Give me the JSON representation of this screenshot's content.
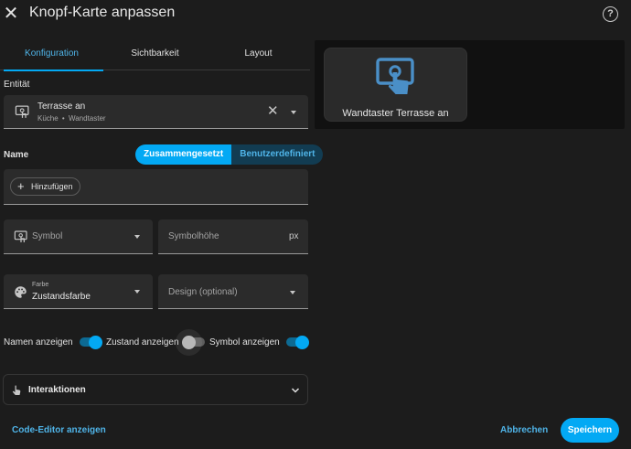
{
  "header": {
    "title": "Knopf-Karte anpassen",
    "close_icon": "close-icon",
    "help_icon": "help-circle-icon"
  },
  "tabs": [
    {
      "label": "Konfiguration",
      "active": true
    },
    {
      "label": "Sichtbarkeit",
      "active": false
    },
    {
      "label": "Layout",
      "active": false
    }
  ],
  "entity": {
    "section_label": "Entität",
    "name": "Terrasse an",
    "area": "Küche",
    "device": "Wandtaster",
    "separator": "•"
  },
  "name_section": {
    "label": "Name",
    "mode_options": [
      "Zusammengesetzt",
      "Benutzerdefiniert"
    ],
    "selected_mode": "Zusammengesetzt",
    "add_label": "Hinzufügen"
  },
  "symbol_field": {
    "placeholder": "Symbol"
  },
  "symbol_height_field": {
    "placeholder": "Symbolhöhe",
    "suffix": "px"
  },
  "color_field": {
    "label": "Farbe",
    "value": "Zustandsfarbe"
  },
  "design_field": {
    "placeholder": "Design (optional)"
  },
  "toggles": [
    {
      "label": "Namen anzeigen",
      "on": true
    },
    {
      "label": "Zustand anzeigen",
      "on": false
    },
    {
      "label": "Symbol anzeigen",
      "on": true
    }
  ],
  "interactions": {
    "label": "Interaktionen"
  },
  "footer": {
    "code_editor": "Code-Editor anzeigen",
    "cancel": "Abbrechen",
    "save": "Speichern"
  },
  "preview": {
    "card_label": "Wandtaster Terrasse an"
  },
  "colors": {
    "accent": "#03a9f4",
    "background": "#1c1c1c",
    "field": "#2b2b2b",
    "preview_bg": "#111111"
  }
}
